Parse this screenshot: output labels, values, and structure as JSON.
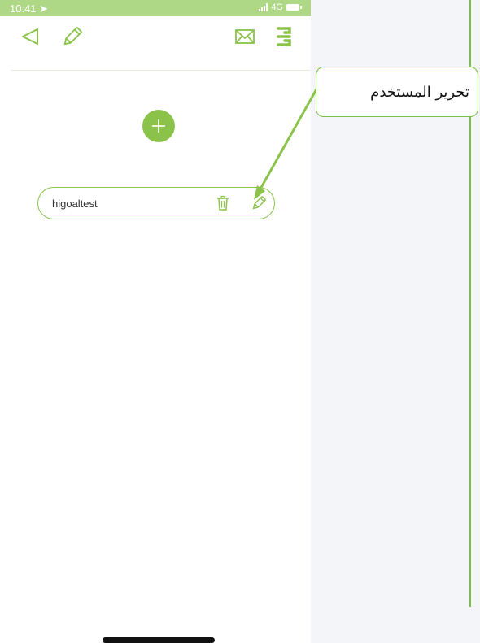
{
  "status_bar": {
    "time": "10:41",
    "network": "4G"
  },
  "header": {
    "back_icon": "back-triangle-icon",
    "edit_icon": "pencil-icon",
    "mail_icon": "envelope-icon",
    "logo_icon": "brand-logo-icon"
  },
  "add_button": {
    "icon": "plus-icon"
  },
  "users": [
    {
      "name": "higoaltest",
      "delete_icon": "trash-icon",
      "edit_icon": "pencil-icon"
    }
  ],
  "annotation": {
    "label": "تحرير المستخدم"
  },
  "colors": {
    "accent": "#8bc34a",
    "status_bar": "#aed886",
    "callout_border": "#7cc242"
  }
}
